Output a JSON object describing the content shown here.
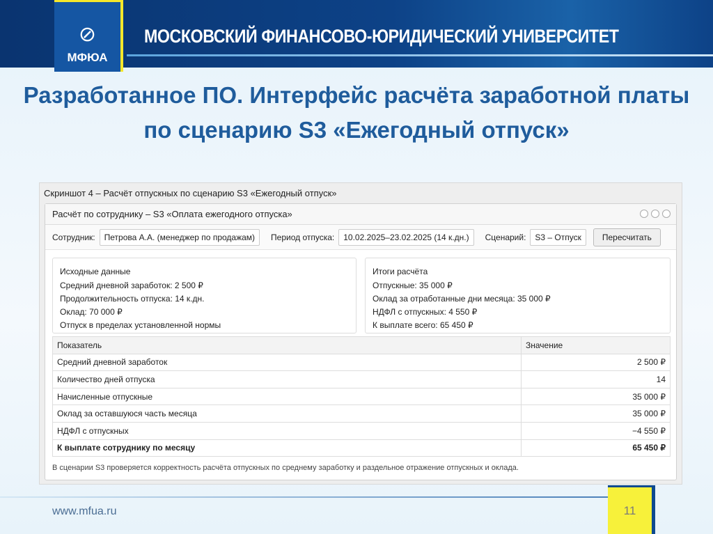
{
  "header": {
    "logo_abbr": "МФЮА",
    "university": "МОСКОВСКИЙ ФИНАНСОВО-ЮРИДИЧЕСКИЙ УНИВЕРСИТЕТ"
  },
  "slide_title": "Разработанное ПО. Интерфейс расчёта заработной платы по сценарию S3 «Ежегодный отпуск»",
  "screenshot": {
    "caption": "Скриншот 4 – Расчёт отпускных по сценарию S3 «Ежегодный отпуск»",
    "window_title": "Расчёт по сотруднику – S3 «Оплата ежегодного отпуска»",
    "form": {
      "employee_label": "Сотрудник:",
      "employee_value": "Петрова А.А. (менеджер по продажам)",
      "period_label": "Период отпуска:",
      "period_value": "10.02.2025–23.02.2025 (14 к.дн.)",
      "scenario_label": "Сценарий:",
      "scenario_value": "S3 – Отпуск",
      "recalc_button": "Пересчитать"
    },
    "input_card": {
      "title": "Исходные данные",
      "lines": [
        "Средний дневной заработок: 2 500 ₽",
        "Продолжительность отпуска: 14 к.дн.",
        "Оклад: 70 000 ₽",
        "Отпуск в пределах установленной нормы"
      ]
    },
    "result_card": {
      "title": "Итоги расчёта",
      "lines": [
        "Отпускные: 35 000 ₽",
        "Оклад за отработанные дни месяца: 35 000 ₽",
        "НДФЛ с отпускных: 4 550 ₽",
        "К выплате всего: 65 450 ₽"
      ]
    },
    "table": {
      "headers": [
        "Показатель",
        "Значение"
      ],
      "rows": [
        [
          "Средний дневной заработок",
          "2 500 ₽"
        ],
        [
          "Количество дней отпуска",
          "14"
        ],
        [
          "Начисленные отпускные",
          "35 000 ₽"
        ],
        [
          "Оклад за оставшуюся часть месяца",
          "35 000 ₽"
        ],
        [
          "НДФЛ с отпускных",
          "−4 550 ₽"
        ],
        [
          "К выплате сотруднику по месяцу",
          "65 450 ₽"
        ]
      ]
    },
    "note": "В сценарии S3 проверяется корректность расчёта отпускных по среднему заработку и раздельное отражение отпускных и оклада."
  },
  "footer": {
    "url": "www.mfua.ru",
    "page_number": "11"
  }
}
